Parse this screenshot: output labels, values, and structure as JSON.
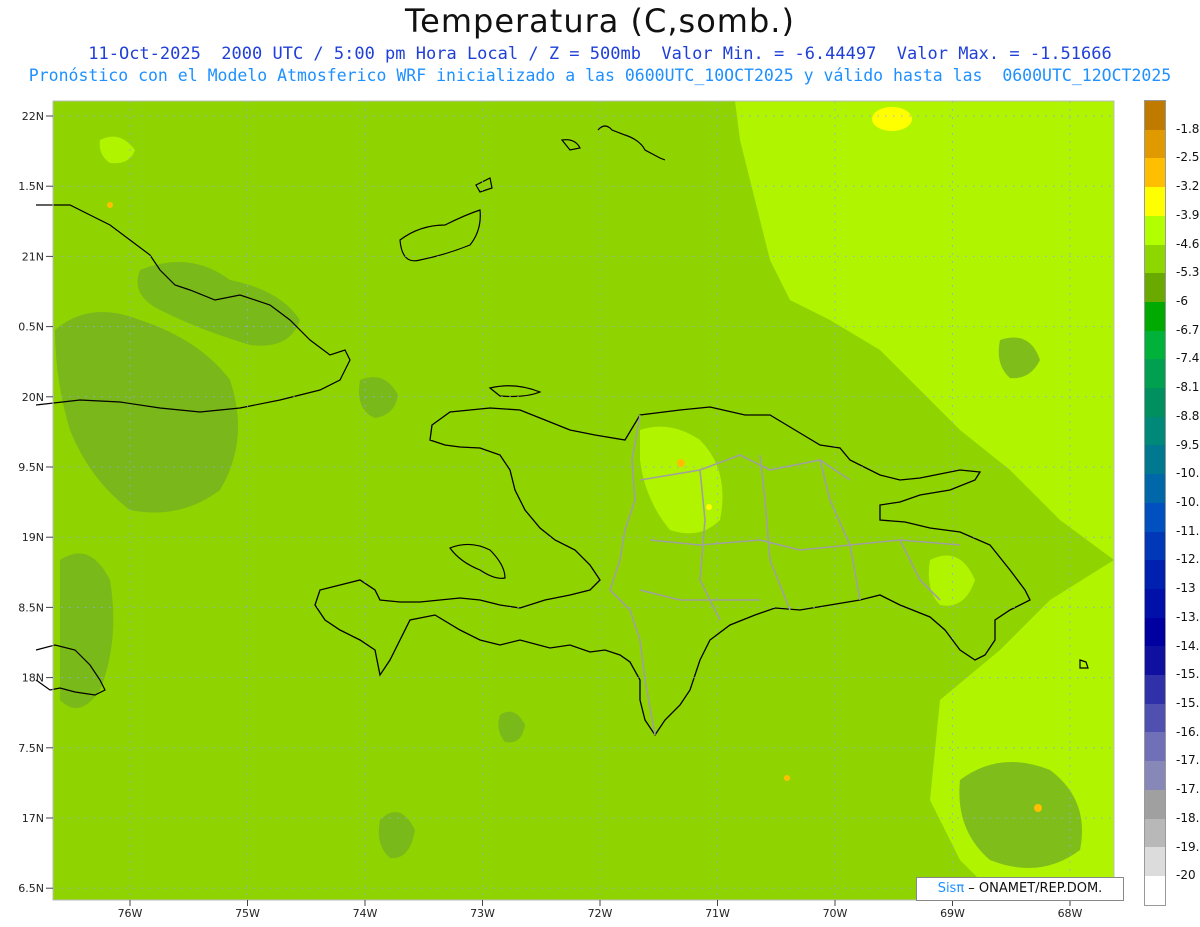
{
  "title": "Temperatura (C,somb.)",
  "subtitle_line1": "11-Oct-2025  2000 UTC / 5:00 pm Hora Local / Z = 500mb  Valor Min. = -6.44497  Valor Max. = -1.51666",
  "subtitle_line2": "Pronóstico con el Modelo Atmosferico WRF inicializado a las 0600UTC_10OCT2025 y válido hasta las  0600UTC_12OCT2025",
  "lat_labels": [
    "22N",
    "1.5N",
    "21N",
    "0.5N",
    "20N",
    "9.5N",
    "19N",
    "8.5N",
    "18N",
    "7.5N",
    "17N",
    "6.5N"
  ],
  "lon_labels": [
    "76W",
    "75W",
    "74W",
    "73W",
    "72W",
    "71W",
    "70W",
    "69W",
    "68W"
  ],
  "colorbar": {
    "labels": [
      "-1.8",
      "-2.5",
      "-3.2",
      "-3.9",
      "-4.6",
      "-5.3",
      "-6",
      "-6.7",
      "-7.4",
      "-8.1",
      "-8.8",
      "-9.5",
      "-10.2",
      "-10.9",
      "-11.6",
      "-12.3",
      "-13",
      "-13.7",
      "-14.4",
      "-15.1",
      "-15.8",
      "-16.5",
      "-17.2",
      "-17.9",
      "-18.6",
      "-19.3",
      "-20"
    ],
    "colors": [
      "#c07a00",
      "#e09a00",
      "#ffbf00",
      "#ffff00",
      "#b2ff00",
      "#8ed600",
      "#6aaa00",
      "#00aa00",
      "#00b23a",
      "#00a050",
      "#009060",
      "#008878",
      "#007890",
      "#0068a8",
      "#0050c0",
      "#0038b8",
      "#0020b0",
      "#0010a8",
      "#0000a0",
      "#1010a0",
      "#3030a8",
      "#5050b0",
      "#7070b8",
      "#8888b8",
      "#a0a0a0",
      "#b8b8b8",
      "#dcdcdc",
      "#ffffff"
    ]
  },
  "credit": {
    "brand": "Sisπ",
    "text": " – ONAMET/REP.DOM."
  },
  "field_colors": {
    "background": "#8fd400",
    "dark_patch": "#77b41e",
    "light_patch": "#b0f400",
    "warm_spot": "#ffff00",
    "border_line": "#a0a0a0",
    "coast_line": "#000000"
  }
}
